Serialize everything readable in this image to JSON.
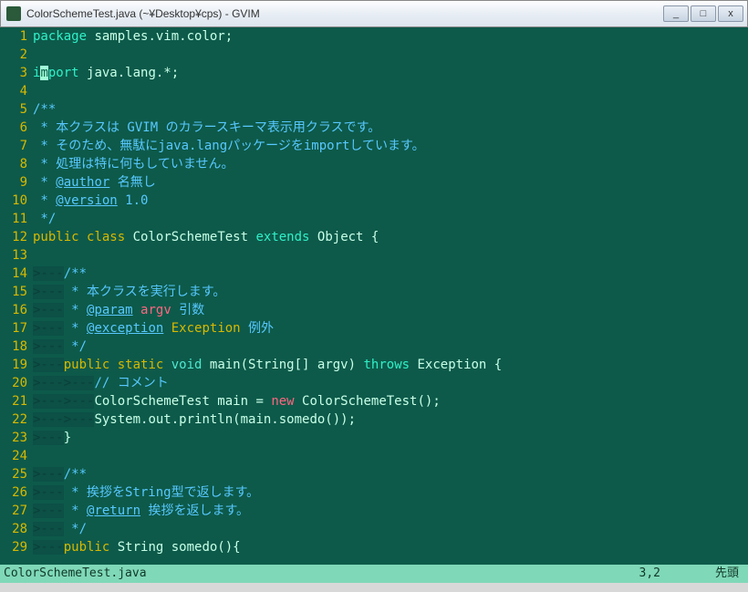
{
  "window": {
    "title": "ColorSchemeTest.java (~¥Desktop¥cps) - GVIM",
    "buttons": {
      "min": "_",
      "max": "□",
      "close": "x"
    }
  },
  "statusbar": {
    "filename": "ColorSchemeTest.java",
    "position": "3,2",
    "mode": "先頭"
  },
  "code": [
    {
      "n": 1,
      "spans": [
        {
          "t": "package",
          "c": "c-keyword"
        },
        {
          "t": " samples.vim.color;",
          "c": ""
        }
      ]
    },
    {
      "n": 2,
      "spans": []
    },
    {
      "n": 3,
      "spans": [
        {
          "t": "i",
          "c": "c-keyword"
        },
        {
          "t": "m",
          "c": "cursor"
        },
        {
          "t": "port",
          "c": "c-keyword"
        },
        {
          "t": " java.lang.*;",
          "c": ""
        }
      ]
    },
    {
      "n": 4,
      "spans": []
    },
    {
      "n": 5,
      "spans": [
        {
          "t": "/**",
          "c": "c-comment"
        }
      ]
    },
    {
      "n": 6,
      "spans": [
        {
          "t": " * 本クラスは GVIM のカラースキーマ表示用クラスです。",
          "c": "c-comment"
        }
      ]
    },
    {
      "n": 7,
      "spans": [
        {
          "t": " * そのため、無駄にjava.langパッケージをimportしています。",
          "c": "c-comment"
        }
      ]
    },
    {
      "n": 8,
      "spans": [
        {
          "t": " * 処理は特に何もしていません。",
          "c": "c-comment"
        }
      ]
    },
    {
      "n": 9,
      "spans": [
        {
          "t": " * ",
          "c": "c-comment"
        },
        {
          "t": "@author",
          "c": "c-annot"
        },
        {
          "t": " 名無し",
          "c": "c-comment"
        }
      ]
    },
    {
      "n": 10,
      "spans": [
        {
          "t": " * ",
          "c": "c-comment"
        },
        {
          "t": "@version",
          "c": "c-annot"
        },
        {
          "t": " 1.0",
          "c": "c-comment"
        }
      ]
    },
    {
      "n": 11,
      "spans": [
        {
          "t": " */",
          "c": "c-comment"
        }
      ]
    },
    {
      "n": 12,
      "spans": [
        {
          "t": "public",
          "c": "c-keyword2"
        },
        {
          "t": " ",
          "c": ""
        },
        {
          "t": "class",
          "c": "c-keyword2"
        },
        {
          "t": " ColorSchemeTest ",
          "c": ""
        },
        {
          "t": "extends",
          "c": "c-keyword"
        },
        {
          "t": " Object {",
          "c": ""
        }
      ]
    },
    {
      "n": 13,
      "spans": []
    },
    {
      "n": 14,
      "spans": [
        {
          "t": ">---",
          "c": "c-marker"
        },
        {
          "t": "/**",
          "c": "c-comment"
        }
      ]
    },
    {
      "n": 15,
      "spans": [
        {
          "t": ">---",
          "c": "c-marker"
        },
        {
          "t": " * 本クラスを実行します。",
          "c": "c-comment"
        }
      ]
    },
    {
      "n": 16,
      "spans": [
        {
          "t": ">---",
          "c": "c-marker"
        },
        {
          "t": " * ",
          "c": "c-comment"
        },
        {
          "t": "@param",
          "c": "c-annot"
        },
        {
          "t": " ",
          "c": "c-comment"
        },
        {
          "t": "argv",
          "c": "c-string"
        },
        {
          "t": " 引数",
          "c": "c-comment"
        }
      ]
    },
    {
      "n": 17,
      "spans": [
        {
          "t": ">---",
          "c": "c-marker"
        },
        {
          "t": " * ",
          "c": "c-comment"
        },
        {
          "t": "@exception",
          "c": "c-annot"
        },
        {
          "t": " ",
          "c": "c-comment"
        },
        {
          "t": "Exception",
          "c": "c-exc"
        },
        {
          "t": " 例外",
          "c": "c-comment"
        }
      ]
    },
    {
      "n": 18,
      "spans": [
        {
          "t": ">---",
          "c": "c-marker"
        },
        {
          "t": " */",
          "c": "c-comment"
        }
      ]
    },
    {
      "n": 19,
      "spans": [
        {
          "t": ">---",
          "c": "c-marker"
        },
        {
          "t": "public",
          "c": "c-keyword2"
        },
        {
          "t": " ",
          "c": ""
        },
        {
          "t": "static",
          "c": "c-keyword2"
        },
        {
          "t": " ",
          "c": ""
        },
        {
          "t": "void",
          "c": "c-type"
        },
        {
          "t": " main(String[] argv) ",
          "c": ""
        },
        {
          "t": "throws",
          "c": "c-keyword"
        },
        {
          "t": " Exception {",
          "c": ""
        }
      ]
    },
    {
      "n": 20,
      "spans": [
        {
          "t": ">--->---",
          "c": "c-marker"
        },
        {
          "t": "// コメント",
          "c": "c-comment"
        }
      ]
    },
    {
      "n": 21,
      "spans": [
        {
          "t": ">--->---",
          "c": "c-marker"
        },
        {
          "t": "ColorSchemeTest main = ",
          "c": ""
        },
        {
          "t": "new",
          "c": "c-string"
        },
        {
          "t": " ColorSchemeTest();",
          "c": ""
        }
      ]
    },
    {
      "n": 22,
      "spans": [
        {
          "t": ">--->---",
          "c": "c-marker"
        },
        {
          "t": "System.out.println(main.somedo());",
          "c": ""
        }
      ]
    },
    {
      "n": 23,
      "spans": [
        {
          "t": ">---",
          "c": "c-marker"
        },
        {
          "t": "}",
          "c": ""
        }
      ]
    },
    {
      "n": 24,
      "spans": []
    },
    {
      "n": 25,
      "spans": [
        {
          "t": ">---",
          "c": "c-marker"
        },
        {
          "t": "/**",
          "c": "c-comment"
        }
      ]
    },
    {
      "n": 26,
      "spans": [
        {
          "t": ">---",
          "c": "c-marker"
        },
        {
          "t": " * 挨拶をString型で返します。",
          "c": "c-comment"
        }
      ]
    },
    {
      "n": 27,
      "spans": [
        {
          "t": ">---",
          "c": "c-marker"
        },
        {
          "t": " * ",
          "c": "c-comment"
        },
        {
          "t": "@return",
          "c": "c-annot"
        },
        {
          "t": " 挨拶を返します。",
          "c": "c-comment"
        }
      ]
    },
    {
      "n": 28,
      "spans": [
        {
          "t": ">---",
          "c": "c-marker"
        },
        {
          "t": " */",
          "c": "c-comment"
        }
      ]
    },
    {
      "n": 29,
      "spans": [
        {
          "t": ">---",
          "c": "c-marker"
        },
        {
          "t": "public",
          "c": "c-keyword2"
        },
        {
          "t": " String somedo(){",
          "c": ""
        }
      ]
    }
  ]
}
